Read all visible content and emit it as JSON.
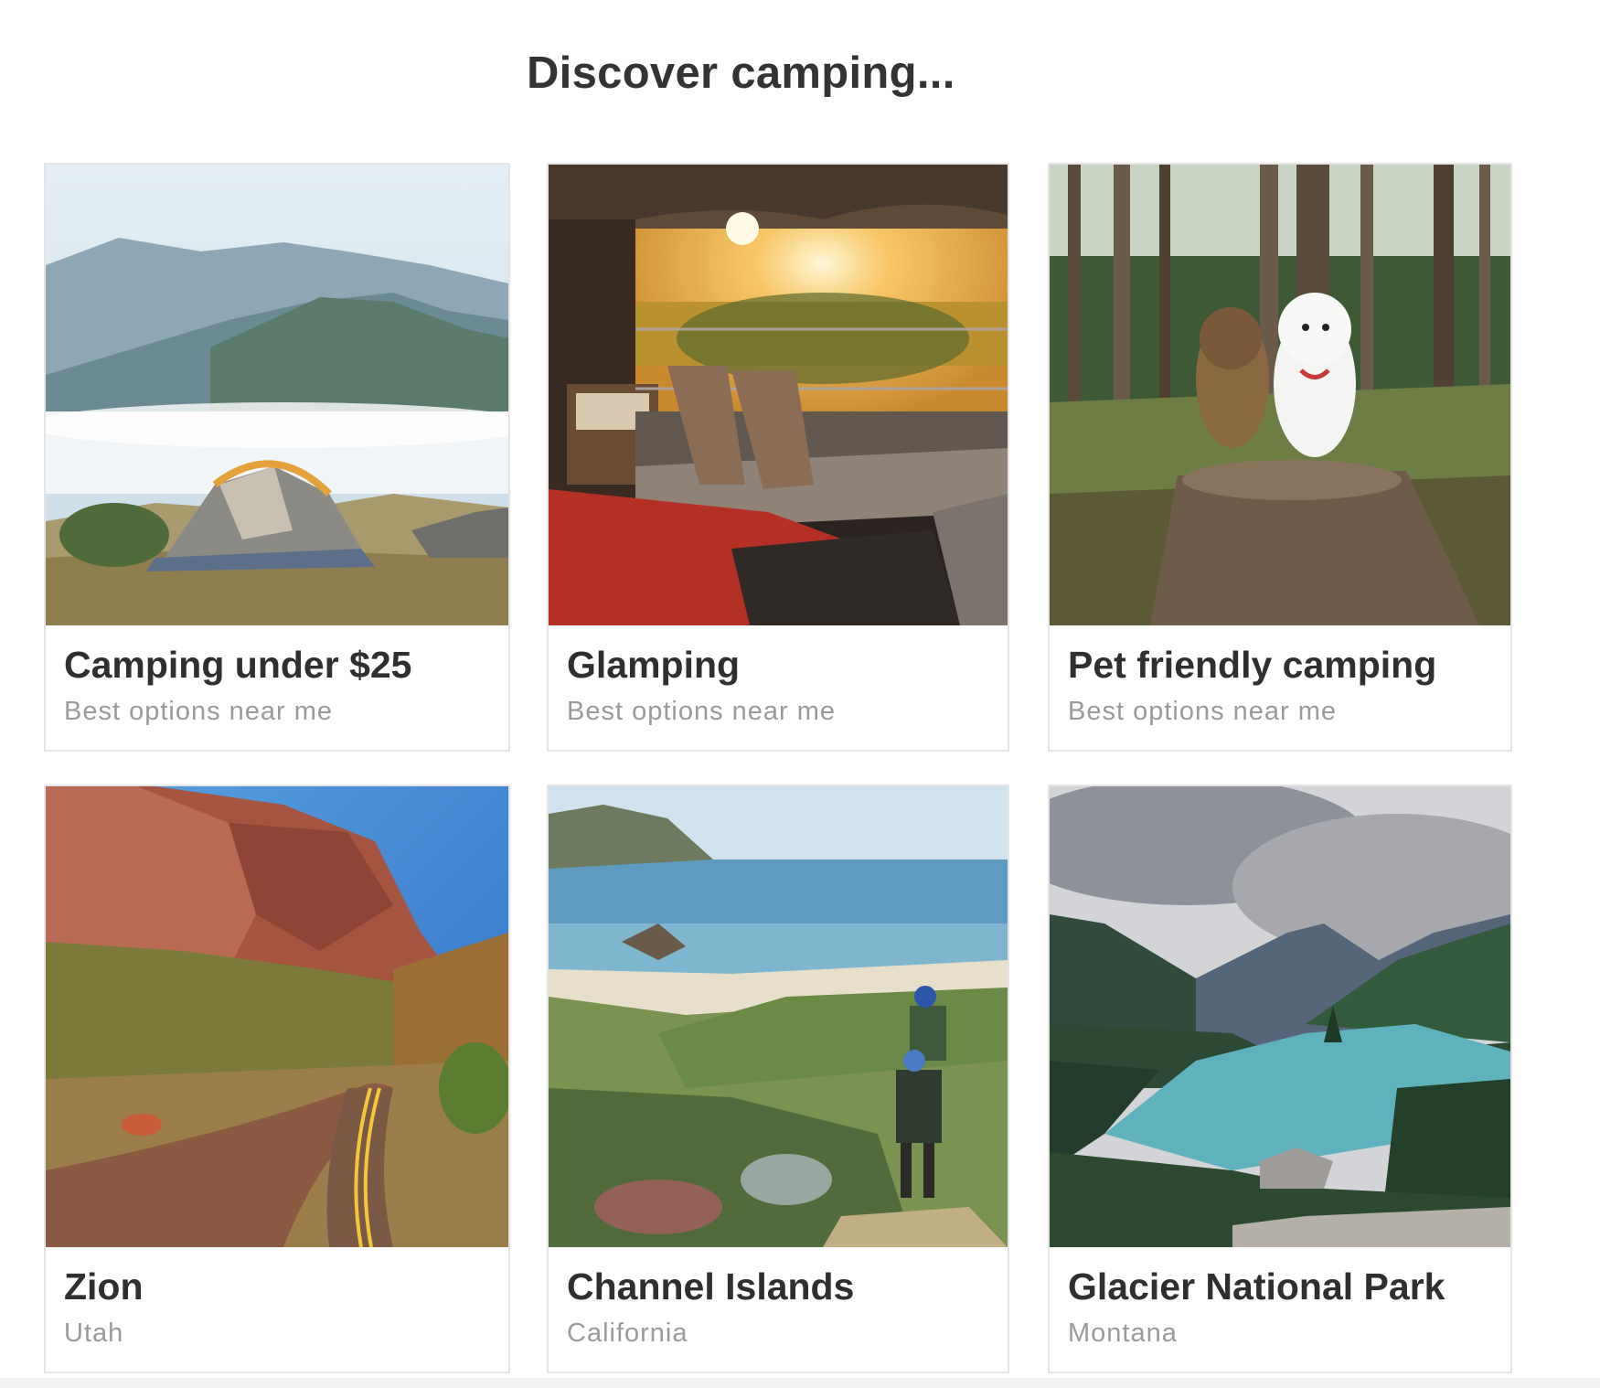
{
  "heading": "Discover camping...",
  "cards": [
    {
      "title": "Camping under $25",
      "subtitle": "Best options near me",
      "image": "tent-on-mountain-ridge-photo"
    },
    {
      "title": "Glamping",
      "subtitle": "Best options near me",
      "image": "glamping-tent-sunset-deck-photo"
    },
    {
      "title": "Pet friendly camping",
      "subtitle": "Best options near me",
      "image": "two-dogs-on-tree-stump-photo"
    },
    {
      "title": "Zion",
      "subtitle": "Utah",
      "image": "zion-canyon-road-photo"
    },
    {
      "title": "Channel Islands",
      "subtitle": "California",
      "image": "coastal-hikers-photo"
    },
    {
      "title": "Glacier National Park",
      "subtitle": "Montana",
      "image": "mountain-lake-overlook-photo"
    }
  ]
}
